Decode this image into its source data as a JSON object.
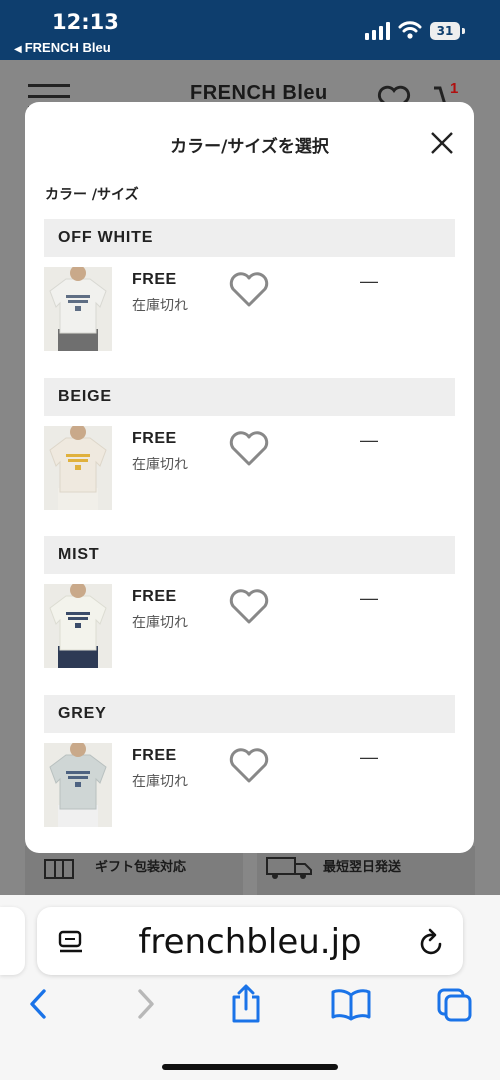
{
  "status_bar": {
    "time": "12:13",
    "back_app": "FRENCH Bleu",
    "battery": "31"
  },
  "page_header": {
    "brand": "FRENCH Bleu",
    "cart_count": "1"
  },
  "page_features": [
    "ギフト包装対応",
    "最短翌日発送"
  ],
  "modal": {
    "title": "カラー/サイズを選択",
    "section_label": "カラー /サイズ",
    "items": [
      {
        "color": "OFF WHITE",
        "size": "FREE",
        "stock": "在庫切れ",
        "dash": "—",
        "swatch": "#f1f1ee",
        "print": "#5f6e84",
        "legs": "#6f6f6f"
      },
      {
        "color": "BEIGE",
        "size": "FREE",
        "stock": "在庫切れ",
        "dash": "—",
        "swatch": "#efe9df",
        "print": "#e0b13d",
        "legs": "#f1efe9"
      },
      {
        "color": "MIST",
        "size": "FREE",
        "stock": "在庫切れ",
        "dash": "—",
        "swatch": "#f3f3ec",
        "print": "#3b4c6a",
        "legs": "#2d3a55"
      },
      {
        "color": "GREY",
        "size": "FREE",
        "stock": "在庫切れ",
        "dash": "—",
        "swatch": "#cfd6d5",
        "print": "#4d6281",
        "legs": "#f0f0f0"
      }
    ]
  },
  "browser": {
    "url": "frenchbleu.jp"
  }
}
